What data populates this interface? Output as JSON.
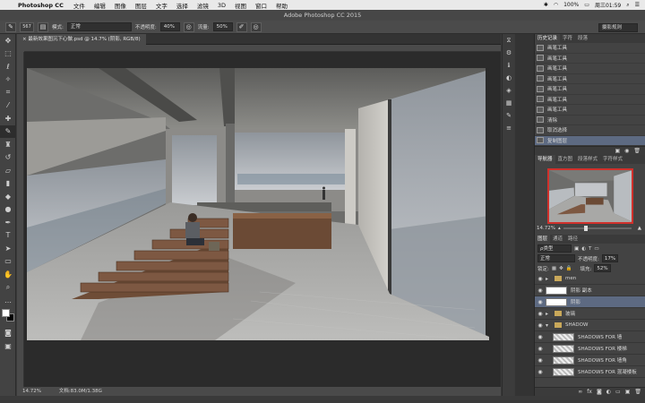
{
  "menubar": {
    "app_name": "Photoshop CC",
    "items": [
      "文件",
      "编辑",
      "图像",
      "图层",
      "文字",
      "选择",
      "滤镜",
      "3D",
      "视图",
      "窗口",
      "帮助"
    ],
    "battery": "100%",
    "clock": "周三01:59"
  },
  "window": {
    "title": "Adobe Photoshop CC 2015"
  },
  "options": {
    "brush_size": "567",
    "mode_label": "模式:",
    "mode_value": "正常",
    "opacity_label": "不透明度:",
    "opacity_value": "40%",
    "flow_label": "流量:",
    "flow_value": "50%",
    "workspace": "摄影规则"
  },
  "document": {
    "tab_title": "最新效果图沉下心做.psd @ 14.7% (阴影, RGB/8)",
    "zoom": "14.72%",
    "doc_size": "文档:83.0M/1.38G"
  },
  "history": {
    "tabs": [
      "历史记录",
      "字符",
      "段落"
    ],
    "items": [
      "画笔工具",
      "画笔工具",
      "画笔工具",
      "画笔工具",
      "画笔工具",
      "画笔工具",
      "画笔工具",
      "清除",
      "取消选择",
      "复制图层"
    ],
    "selected_index": 9
  },
  "navigator": {
    "tabs": [
      "导航器",
      "直方图",
      "段落样式",
      "字符样式"
    ],
    "zoom": "14.72%"
  },
  "layers": {
    "tabs": [
      "图层",
      "通道",
      "路径"
    ],
    "filter_label": "ρ类型",
    "blend_mode": "正常",
    "opacity_label": "不透明度:",
    "opacity_value": "17%",
    "lock_label": "锁定:",
    "fill_label": "填充:",
    "fill_value": "52%",
    "rows": [
      {
        "name": "men",
        "kind": "group"
      },
      {
        "name": "阴影 副本",
        "kind": "layer"
      },
      {
        "name": "阴影",
        "kind": "layer"
      },
      {
        "name": "玻璃",
        "kind": "group"
      },
      {
        "name": "SHADOW",
        "kind": "group"
      },
      {
        "name": "SHADOWS FOR 墙",
        "kind": "layer"
      },
      {
        "name": "SHADOWS FOR 楼梯",
        "kind": "layer"
      },
      {
        "name": "SHADOWS FOR 墙角",
        "kind": "layer"
      },
      {
        "name": "SHADOWS FOR 混凝楼板",
        "kind": "layer"
      }
    ],
    "selected_index": 2
  },
  "colors": {
    "accent": "#5d6a82",
    "nav_frame": "#d0302b"
  }
}
